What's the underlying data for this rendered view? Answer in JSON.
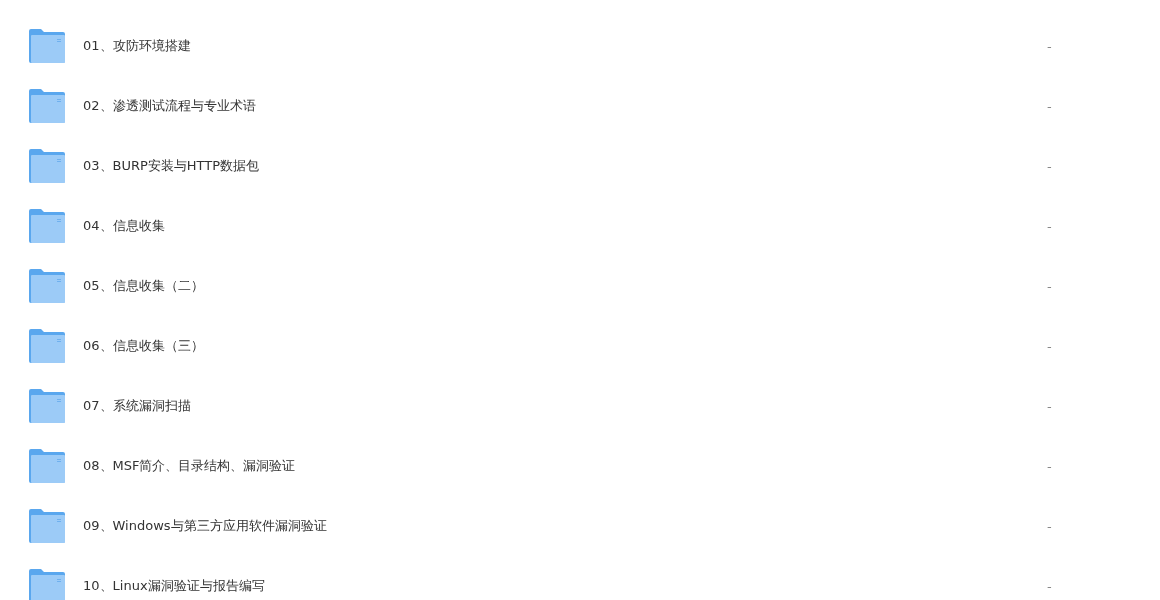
{
  "files": [
    {
      "name": "01、攻防环境搭建",
      "size": "-"
    },
    {
      "name": "02、渗透测试流程与专业术语",
      "size": "-"
    },
    {
      "name": "03、BURP安装与HTTP数据包",
      "size": "-"
    },
    {
      "name": "04、信息收集",
      "size": "-"
    },
    {
      "name": "05、信息收集（二）",
      "size": "-"
    },
    {
      "name": "06、信息收集（三）",
      "size": "-"
    },
    {
      "name": "07、系统漏洞扫描",
      "size": "-"
    },
    {
      "name": "08、MSF简介、目录结构、漏洞验证",
      "size": "-"
    },
    {
      "name": "09、Windows与第三方应用软件漏洞验证",
      "size": "-"
    },
    {
      "name": "10、Linux漏洞验证与报告编写",
      "size": "-"
    }
  ]
}
